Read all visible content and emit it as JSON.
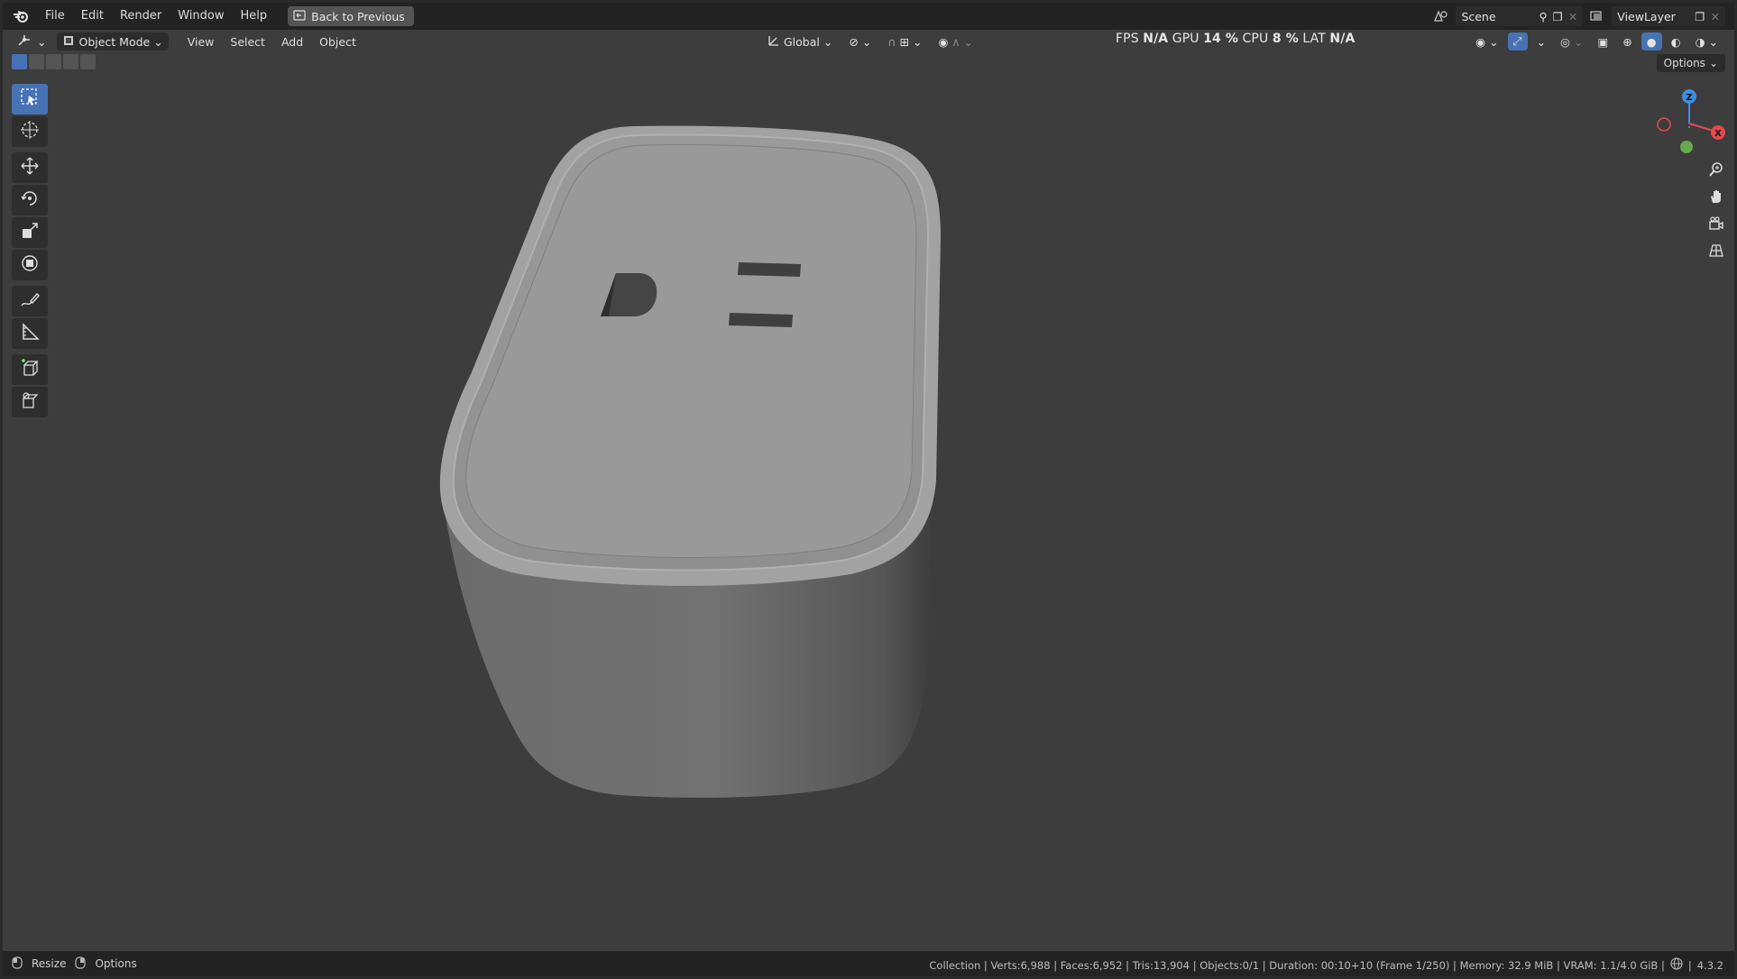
{
  "menubar": {
    "items": [
      "File",
      "Edit",
      "Render",
      "Window",
      "Help"
    ],
    "back_button": "Back to Previous",
    "scene_name": "Scene",
    "view_layer": "ViewLayer"
  },
  "viewport_header": {
    "mode": "Object Mode",
    "menus": [
      "View",
      "Select",
      "Add",
      "Object"
    ],
    "orientation": "Global",
    "options": "Options"
  },
  "stats": {
    "fps_label": "FPS",
    "fps_value": "N/A",
    "gpu_label": "GPU",
    "gpu_value": "14 %",
    "cpu_label": "CPU",
    "cpu_value": "8 %",
    "lat_label": "LAT",
    "lat_value": "N/A"
  },
  "gizmo": {
    "z": "Z",
    "x": "X"
  },
  "statusbar": {
    "resize": "Resize",
    "options": "Options",
    "info": "Collection | Verts:6,988 | Faces:6,952 | Tris:13,904 | Objects:0/1 | Duration: 00:10+10 (Frame 1/250) | Memory: 32.9 MiB | VRAM: 1.1/4.0 GiB |",
    "version": "4.3.2"
  },
  "colors": {
    "accent": "#4772b3",
    "viewport_bg": "#3d3d3d",
    "axis_x": "#e5484d",
    "axis_y": "#6aa84f",
    "axis_z": "#3d8ee0"
  }
}
